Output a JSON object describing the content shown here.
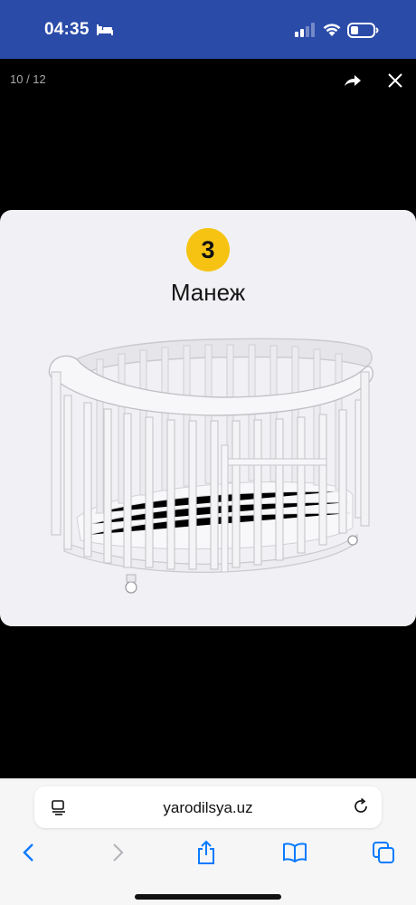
{
  "status_bar": {
    "time": "04:35",
    "icons": [
      "bed-icon",
      "cellular-signal-icon",
      "wifi-icon",
      "battery-icon"
    ],
    "background_color": "#2a4ba8"
  },
  "viewer": {
    "counter": "10 / 12",
    "share_icon": "share-arrow-icon",
    "close_icon": "close-icon",
    "card": {
      "badge_number": "3",
      "badge_color": "#f6c313",
      "title": "Манеж",
      "image_subject": "crib-image"
    }
  },
  "browser": {
    "url": "yarodilsya.uz",
    "toolbar": [
      "back-icon",
      "forward-icon",
      "share-icon",
      "bookmarks-icon",
      "tabs-icon"
    ],
    "accent_color": "#0a7aff"
  }
}
